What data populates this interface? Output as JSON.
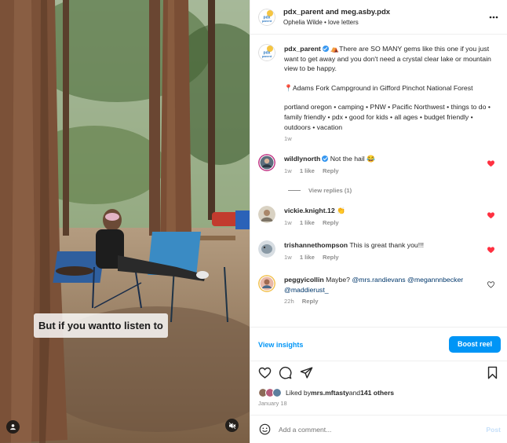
{
  "media": {
    "overlay_caption": "But if you wantto listen to",
    "tag_icon": "user-tag-icon",
    "mute_icon": "speaker-muted-icon"
  },
  "header": {
    "title": "pdx_parent and meg.asby.pdx",
    "subtitle": "Ophelia Wilde • love letters",
    "avatar_logo_text": "pdx parent",
    "more_icon": "more-horizontal-icon"
  },
  "caption": {
    "username": "pdx_parent",
    "text": "⛺There are SO MANY gems like this one if you just want to get away and you don't need a crystal clear lake or mountain view to be happy.",
    "location": "📍Adams Fork Campground in Gifford Pinchot National Forest",
    "tags": "portland oregon • camping • PNW • Pacific Northwest • things to do • family friendly • pdx • good for kids • all ages • budget friendly • outdoors • vacation",
    "time": "1w"
  },
  "comments": [
    {
      "username": "wildlynorth",
      "verified": true,
      "text": "Not the hail 😂",
      "time": "1w",
      "likes": "1 like",
      "reply": "Reply",
      "liked": true,
      "view_replies": "View replies (1)"
    },
    {
      "username": "vickie.knight.12",
      "verified": false,
      "text": "👏",
      "time": "1w",
      "likes": "1 like",
      "reply": "Reply",
      "liked": true
    },
    {
      "username": "trishannethompson",
      "verified": false,
      "text": "This is great thank you!!!",
      "time": "1w",
      "likes": "1 like",
      "reply": "Reply",
      "liked": true
    },
    {
      "username": "peggyicollin",
      "verified": false,
      "text_before": "Maybe? ",
      "mentions": "@mrs.randievans @megannnbecker @maddierust_",
      "time": "22h",
      "reply": "Reply",
      "liked": false
    }
  ],
  "insights": {
    "view_label": "View insights",
    "boost_label": "Boost reel"
  },
  "actions": {
    "icons": [
      "heart-icon",
      "comment-icon",
      "share-icon",
      "save-icon"
    ]
  },
  "likes": {
    "prefix": "Liked by ",
    "user": "mrs.mftasty",
    "middle": " and ",
    "others": "141 others"
  },
  "date": "January 18",
  "add_comment": {
    "placeholder": "Add a comment...",
    "post_label": "Post",
    "emoji_icon": "emoji-icon"
  },
  "colors": {
    "accent": "#0095f6",
    "heart": "#ff3040",
    "muted": "#8e8e8e",
    "verified": "#3797f0"
  }
}
